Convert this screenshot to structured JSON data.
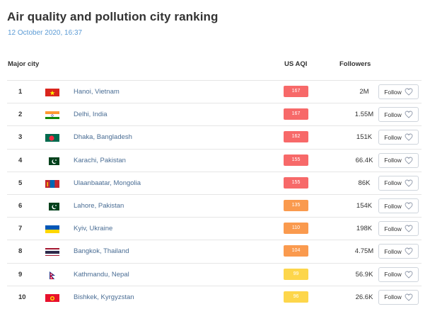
{
  "header": {
    "title": "Air quality and pollution city ranking",
    "timestamp": "12 October 2020, 16:37"
  },
  "columns": {
    "city": "Major city",
    "aqi": "US AQI",
    "followers": "Followers"
  },
  "follow_label": "Follow",
  "colors": {
    "unhealthy": "#f76969",
    "sensitive": "#fa9a4e",
    "moderate": "#fdd64b"
  },
  "rows": [
    {
      "rank": "1",
      "flag": "vietnam-flag",
      "city": "Hanoi, Vietnam",
      "aqi": "167",
      "level": "unhealthy",
      "followers": "2M"
    },
    {
      "rank": "2",
      "flag": "india-flag",
      "city": "Delhi, India",
      "aqi": "167",
      "level": "unhealthy",
      "followers": "1.55M"
    },
    {
      "rank": "3",
      "flag": "bangladesh-flag",
      "city": "Dhaka, Bangladesh",
      "aqi": "162",
      "level": "unhealthy",
      "followers": "151K"
    },
    {
      "rank": "4",
      "flag": "pakistan-flag",
      "city": "Karachi, Pakistan",
      "aqi": "155",
      "level": "unhealthy",
      "followers": "66.4K"
    },
    {
      "rank": "5",
      "flag": "mongolia-flag",
      "city": "Ulaanbaatar, Mongolia",
      "aqi": "155",
      "level": "unhealthy",
      "followers": "86K"
    },
    {
      "rank": "6",
      "flag": "pakistan-flag",
      "city": "Lahore, Pakistan",
      "aqi": "135",
      "level": "sensitive",
      "followers": "154K"
    },
    {
      "rank": "7",
      "flag": "ukraine-flag",
      "city": "Kyiv, Ukraine",
      "aqi": "110",
      "level": "sensitive",
      "followers": "198K"
    },
    {
      "rank": "8",
      "flag": "thailand-flag",
      "city": "Bangkok, Thailand",
      "aqi": "104",
      "level": "sensitive",
      "followers": "4.75M"
    },
    {
      "rank": "9",
      "flag": "nepal-flag",
      "city": "Kathmandu, Nepal",
      "aqi": "99",
      "level": "moderate",
      "followers": "56.9K"
    },
    {
      "rank": "10",
      "flag": "kyrgyzstan-flag",
      "city": "Bishkek, Kyrgyzstan",
      "aqi": "96",
      "level": "moderate",
      "followers": "26.6K"
    }
  ]
}
